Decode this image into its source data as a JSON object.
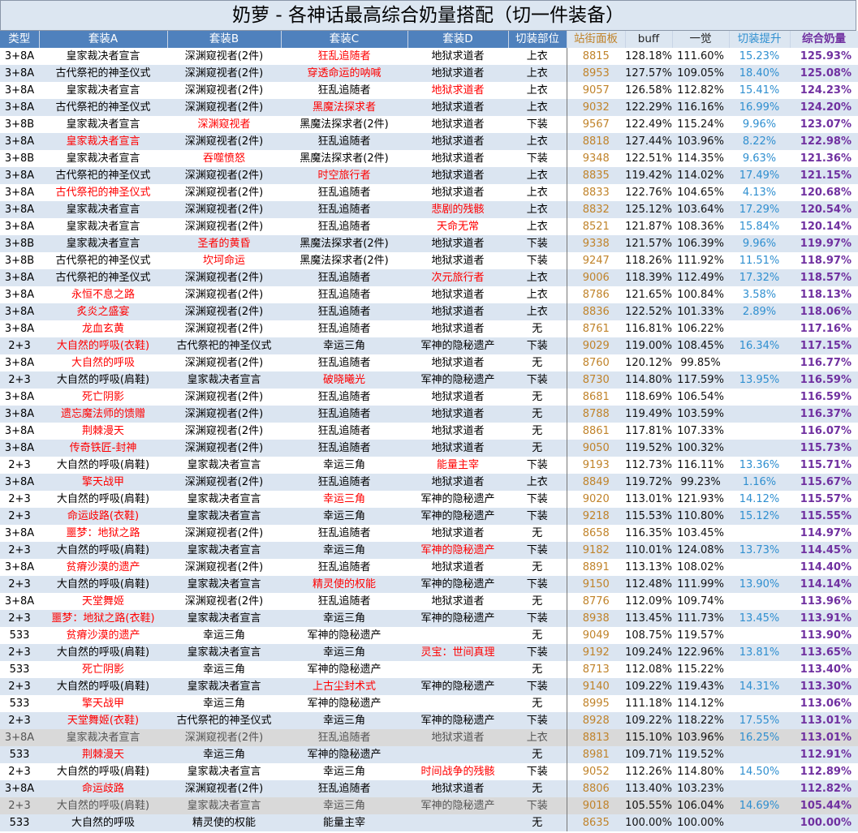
{
  "title": "奶萝 - 各神话最高综合奶量搭配（切一件装备）",
  "columns": [
    "类型",
    "套装A",
    "套装B",
    "套装C",
    "套装D",
    "切装部位",
    "站街面板",
    "buff",
    "一觉",
    "切装提升",
    "综合奶量"
  ],
  "rows": [
    {
      "type": "3+8A",
      "a": "皇家裁决者宣言",
      "b": "深渊窥视者(2件)",
      "c": "狂乱追随者",
      "d": "地狱求道者",
      "part": "上衣",
      "panel": "8815",
      "buff": "128.18%",
      "ov": "111.60%",
      "sw": "15.23%",
      "total": "125.93%",
      "red": [
        "c"
      ]
    },
    {
      "type": "3+8A",
      "a": "古代祭祀的神圣仪式",
      "b": "深渊窥视者(2件)",
      "c": "穿透命运的呐喊",
      "d": "地狱求道者",
      "part": "上衣",
      "panel": "8953",
      "buff": "127.57%",
      "ov": "109.05%",
      "sw": "18.40%",
      "total": "125.08%",
      "red": [
        "c"
      ]
    },
    {
      "type": "3+8A",
      "a": "皇家裁决者宣言",
      "b": "深渊窥视者(2件)",
      "c": "狂乱追随者",
      "d": "地狱求道者",
      "part": "上衣",
      "panel": "9057",
      "buff": "126.58%",
      "ov": "112.82%",
      "sw": "15.41%",
      "total": "124.23%",
      "red": [
        "d"
      ]
    },
    {
      "type": "3+8A",
      "a": "古代祭祀的神圣仪式",
      "b": "深渊窥视者(2件)",
      "c": "黑魔法探求者",
      "d": "地狱求道者",
      "part": "上衣",
      "panel": "9032",
      "buff": "122.29%",
      "ov": "116.16%",
      "sw": "16.99%",
      "total": "124.20%",
      "red": [
        "c"
      ]
    },
    {
      "type": "3+8B",
      "a": "皇家裁决者宣言",
      "b": "深渊窥视者",
      "c": "黑魔法探求者(2件)",
      "d": "地狱求道者",
      "part": "下装",
      "panel": "9567",
      "buff": "122.49%",
      "ov": "115.24%",
      "sw": "9.96%",
      "total": "123.07%",
      "red": [
        "b"
      ]
    },
    {
      "type": "3+8A",
      "a": "皇家裁决者宣言",
      "b": "深渊窥视者(2件)",
      "c": "狂乱追随者",
      "d": "地狱求道者",
      "part": "上衣",
      "panel": "8818",
      "buff": "127.44%",
      "ov": "103.96%",
      "sw": "8.22%",
      "total": "122.98%",
      "red": [
        "a"
      ]
    },
    {
      "type": "3+8B",
      "a": "皇家裁决者宣言",
      "b": "吞噬愤怒",
      "c": "黑魔法探求者(2件)",
      "d": "地狱求道者",
      "part": "下装",
      "panel": "9348",
      "buff": "122.51%",
      "ov": "114.35%",
      "sw": "9.63%",
      "total": "121.36%",
      "red": [
        "b"
      ]
    },
    {
      "type": "3+8A",
      "a": "古代祭祀的神圣仪式",
      "b": "深渊窥视者(2件)",
      "c": "时空旅行者",
      "d": "地狱求道者",
      "part": "上衣",
      "panel": "8835",
      "buff": "119.42%",
      "ov": "114.02%",
      "sw": "17.49%",
      "total": "121.15%",
      "red": [
        "c"
      ]
    },
    {
      "type": "3+8A",
      "a": "古代祭祀的神圣仪式",
      "b": "深渊窥视者(2件)",
      "c": "狂乱追随者",
      "d": "地狱求道者",
      "part": "上衣",
      "panel": "8833",
      "buff": "122.76%",
      "ov": "104.65%",
      "sw": "4.13%",
      "total": "120.68%",
      "red": [
        "a"
      ]
    },
    {
      "type": "3+8A",
      "a": "皇家裁决者宣言",
      "b": "深渊窥视者(2件)",
      "c": "狂乱追随者",
      "d": "悲剧的残骸",
      "part": "上衣",
      "panel": "8832",
      "buff": "125.12%",
      "ov": "103.64%",
      "sw": "17.29%",
      "total": "120.54%",
      "red": [
        "d"
      ]
    },
    {
      "type": "3+8A",
      "a": "皇家裁决者宣言",
      "b": "深渊窥视者(2件)",
      "c": "狂乱追随者",
      "d": "天命无常",
      "part": "上衣",
      "panel": "8521",
      "buff": "121.87%",
      "ov": "108.36%",
      "sw": "15.84%",
      "total": "120.14%",
      "red": [
        "d"
      ]
    },
    {
      "type": "3+8B",
      "a": "皇家裁决者宣言",
      "b": "圣者的黄昏",
      "c": "黑魔法探求者(2件)",
      "d": "地狱求道者",
      "part": "下装",
      "panel": "9338",
      "buff": "121.57%",
      "ov": "106.39%",
      "sw": "9.96%",
      "total": "119.97%",
      "red": [
        "b"
      ]
    },
    {
      "type": "3+8B",
      "a": "古代祭祀的神圣仪式",
      "b": "坎坷命运",
      "c": "黑魔法探求者(2件)",
      "d": "地狱求道者",
      "part": "下装",
      "panel": "9247",
      "buff": "118.26%",
      "ov": "111.92%",
      "sw": "11.51%",
      "total": "118.97%",
      "red": [
        "b"
      ]
    },
    {
      "type": "3+8A",
      "a": "古代祭祀的神圣仪式",
      "b": "深渊窥视者(2件)",
      "c": "狂乱追随者",
      "d": "次元旅行者",
      "part": "上衣",
      "panel": "9006",
      "buff": "118.39%",
      "ov": "112.49%",
      "sw": "17.32%",
      "total": "118.57%",
      "red": [
        "d"
      ]
    },
    {
      "type": "3+8A",
      "a": "永恒不息之路",
      "b": "深渊窥视者(2件)",
      "c": "狂乱追随者",
      "d": "地狱求道者",
      "part": "上衣",
      "panel": "8786",
      "buff": "121.65%",
      "ov": "100.84%",
      "sw": "3.58%",
      "total": "118.13%",
      "red": [
        "a"
      ]
    },
    {
      "type": "3+8A",
      "a": "炙炎之盛宴",
      "b": "深渊窥视者(2件)",
      "c": "狂乱追随者",
      "d": "地狱求道者",
      "part": "上衣",
      "panel": "8836",
      "buff": "122.52%",
      "ov": "101.33%",
      "sw": "2.89%",
      "total": "118.06%",
      "red": [
        "a"
      ]
    },
    {
      "type": "3+8A",
      "a": "龙血玄黄",
      "b": "深渊窥视者(2件)",
      "c": "狂乱追随者",
      "d": "地狱求道者",
      "part": "无",
      "panel": "8761",
      "buff": "116.81%",
      "ov": "106.22%",
      "sw": "",
      "total": "117.16%",
      "red": [
        "a"
      ]
    },
    {
      "type": "2+3",
      "a": "大自然的呼吸(衣鞋)",
      "b": "古代祭祀的神圣仪式",
      "c": "幸运三角",
      "d": "军神的隐秘遗产",
      "part": "下装",
      "panel": "9029",
      "buff": "119.00%",
      "ov": "108.45%",
      "sw": "16.34%",
      "total": "117.15%",
      "red": [
        "a"
      ]
    },
    {
      "type": "3+8A",
      "a": "大自然的呼吸",
      "b": "深渊窥视者(2件)",
      "c": "狂乱追随者",
      "d": "地狱求道者",
      "part": "无",
      "panel": "8760",
      "buff": "120.12%",
      "ov": "99.85%",
      "sw": "",
      "total": "116.77%",
      "red": [
        "a"
      ]
    },
    {
      "type": "2+3",
      "a": "大自然的呼吸(肩鞋)",
      "b": "皇家裁决者宣言",
      "c": "破晓曦光",
      "d": "军神的隐秘遗产",
      "part": "下装",
      "panel": "8730",
      "buff": "114.80%",
      "ov": "117.59%",
      "sw": "13.95%",
      "total": "116.59%",
      "red": [
        "c"
      ]
    },
    {
      "type": "3+8A",
      "a": "死亡阴影",
      "b": "深渊窥视者(2件)",
      "c": "狂乱追随者",
      "d": "地狱求道者",
      "part": "无",
      "panel": "8681",
      "buff": "118.69%",
      "ov": "106.54%",
      "sw": "",
      "total": "116.59%",
      "red": [
        "a"
      ]
    },
    {
      "type": "3+8A",
      "a": "遗忘魔法师的馈赠",
      "b": "深渊窥视者(2件)",
      "c": "狂乱追随者",
      "d": "地狱求道者",
      "part": "无",
      "panel": "8788",
      "buff": "119.49%",
      "ov": "103.59%",
      "sw": "",
      "total": "116.37%",
      "red": [
        "a"
      ]
    },
    {
      "type": "3+8A",
      "a": "荆棘漫天",
      "b": "深渊窥视者(2件)",
      "c": "狂乱追随者",
      "d": "地狱求道者",
      "part": "无",
      "panel": "8861",
      "buff": "117.81%",
      "ov": "107.33%",
      "sw": "",
      "total": "116.07%",
      "red": [
        "a"
      ]
    },
    {
      "type": "3+8A",
      "a": "传奇铁匠-封神",
      "b": "深渊窥视者(2件)",
      "c": "狂乱追随者",
      "d": "地狱求道者",
      "part": "无",
      "panel": "9050",
      "buff": "119.52%",
      "ov": "100.32%",
      "sw": "",
      "total": "115.73%",
      "red": [
        "a"
      ]
    },
    {
      "type": "2+3",
      "a": "大自然的呼吸(肩鞋)",
      "b": "皇家裁决者宣言",
      "c": "幸运三角",
      "d": "能量主宰",
      "part": "下装",
      "panel": "9193",
      "buff": "112.73%",
      "ov": "116.11%",
      "sw": "13.36%",
      "total": "115.71%",
      "red": [
        "d"
      ]
    },
    {
      "type": "3+8A",
      "a": "擎天战甲",
      "b": "深渊窥视者(2件)",
      "c": "狂乱追随者",
      "d": "地狱求道者",
      "part": "上衣",
      "panel": "8849",
      "buff": "119.72%",
      "ov": "99.23%",
      "sw": "1.16%",
      "total": "115.67%",
      "red": [
        "a"
      ]
    },
    {
      "type": "2+3",
      "a": "大自然的呼吸(肩鞋)",
      "b": "皇家裁决者宣言",
      "c": "幸运三角",
      "d": "军神的隐秘遗产",
      "part": "下装",
      "panel": "9020",
      "buff": "113.01%",
      "ov": "121.93%",
      "sw": "14.12%",
      "total": "115.57%",
      "red": [
        "c"
      ]
    },
    {
      "type": "2+3",
      "a": "命运歧路(衣鞋)",
      "b": "皇家裁决者宣言",
      "c": "幸运三角",
      "d": "军神的隐秘遗产",
      "part": "下装",
      "panel": "9218",
      "buff": "115.53%",
      "ov": "110.80%",
      "sw": "15.12%",
      "total": "115.55%",
      "red": [
        "a"
      ]
    },
    {
      "type": "3+8A",
      "a": "噩梦：地狱之路",
      "b": "深渊窥视者(2件)",
      "c": "狂乱追随者",
      "d": "地狱求道者",
      "part": "无",
      "panel": "8658",
      "buff": "116.35%",
      "ov": "103.45%",
      "sw": "",
      "total": "114.97%",
      "red": [
        "a"
      ]
    },
    {
      "type": "2+3",
      "a": "大自然的呼吸(肩鞋)",
      "b": "皇家裁决者宣言",
      "c": "幸运三角",
      "d": "军神的隐秘遗产",
      "part": "下装",
      "panel": "9182",
      "buff": "110.01%",
      "ov": "124.08%",
      "sw": "13.73%",
      "total": "114.45%",
      "red": [
        "d"
      ]
    },
    {
      "type": "3+8A",
      "a": "贫瘠沙漠的遗产",
      "b": "深渊窥视者(2件)",
      "c": "狂乱追随者",
      "d": "地狱求道者",
      "part": "无",
      "panel": "8891",
      "buff": "113.13%",
      "ov": "108.02%",
      "sw": "",
      "total": "114.40%",
      "red": [
        "a"
      ]
    },
    {
      "type": "2+3",
      "a": "大自然的呼吸(肩鞋)",
      "b": "皇家裁决者宣言",
      "c": "精灵使的权能",
      "d": "军神的隐秘遗产",
      "part": "下装",
      "panel": "9150",
      "buff": "112.48%",
      "ov": "111.99%",
      "sw": "13.90%",
      "total": "114.14%",
      "red": [
        "c"
      ]
    },
    {
      "type": "3+8A",
      "a": "天堂舞姬",
      "b": "深渊窥视者(2件)",
      "c": "狂乱追随者",
      "d": "地狱求道者",
      "part": "无",
      "panel": "8776",
      "buff": "112.09%",
      "ov": "109.74%",
      "sw": "",
      "total": "113.96%",
      "red": [
        "a"
      ]
    },
    {
      "type": "2+3",
      "a": "噩梦：地狱之路(衣鞋)",
      "b": "皇家裁决者宣言",
      "c": "幸运三角",
      "d": "军神的隐秘遗产",
      "part": "下装",
      "panel": "8938",
      "buff": "113.45%",
      "ov": "111.73%",
      "sw": "13.45%",
      "total": "113.91%",
      "red": [
        "a"
      ]
    },
    {
      "type": "533",
      "a": "贫瘠沙漠的遗产",
      "b": "幸运三角",
      "c": "军神的隐秘遗产",
      "d": "",
      "part": "无",
      "panel": "9049",
      "buff": "108.75%",
      "ov": "119.57%",
      "sw": "",
      "total": "113.90%",
      "red": [
        "a"
      ]
    },
    {
      "type": "2+3",
      "a": "大自然的呼吸(肩鞋)",
      "b": "皇家裁决者宣言",
      "c": "幸运三角",
      "d": "灵宝：世间真理",
      "part": "下装",
      "panel": "9192",
      "buff": "109.24%",
      "ov": "122.96%",
      "sw": "13.81%",
      "total": "113.65%",
      "red": [
        "d"
      ]
    },
    {
      "type": "533",
      "a": "死亡阴影",
      "b": "幸运三角",
      "c": "军神的隐秘遗产",
      "d": "",
      "part": "无",
      "panel": "8713",
      "buff": "112.08%",
      "ov": "115.22%",
      "sw": "",
      "total": "113.40%",
      "red": [
        "a"
      ]
    },
    {
      "type": "2+3",
      "a": "大自然的呼吸(肩鞋)",
      "b": "皇家裁决者宣言",
      "c": "上古尘封术式",
      "d": "军神的隐秘遗产",
      "part": "下装",
      "panel": "9140",
      "buff": "109.22%",
      "ov": "119.43%",
      "sw": "14.31%",
      "total": "113.30%",
      "red": [
        "c"
      ]
    },
    {
      "type": "533",
      "a": "擎天战甲",
      "b": "幸运三角",
      "c": "军神的隐秘遗产",
      "d": "",
      "part": "无",
      "panel": "8995",
      "buff": "111.18%",
      "ov": "114.12%",
      "sw": "",
      "total": "113.06%",
      "red": [
        "a"
      ]
    },
    {
      "type": "2+3",
      "a": "天堂舞姬(衣鞋)",
      "b": "古代祭祀的神圣仪式",
      "c": "幸运三角",
      "d": "军神的隐秘遗产",
      "part": "下装",
      "panel": "8928",
      "buff": "109.22%",
      "ov": "118.22%",
      "sw": "17.55%",
      "total": "113.01%",
      "red": [
        "a"
      ]
    },
    {
      "type": "3+8A",
      "a": "皇家裁决者宣言",
      "b": "深渊窥视者(2件)",
      "c": "狂乱追随者",
      "d": "地狱求道者",
      "part": "上衣",
      "panel": "8813",
      "buff": "115.10%",
      "ov": "103.96%",
      "sw": "16.25%",
      "total": "113.01%",
      "red": [],
      "grey": true
    },
    {
      "type": "533",
      "a": "荆棘漫天",
      "b": "幸运三角",
      "c": "军神的隐秘遗产",
      "d": "",
      "part": "无",
      "panel": "8981",
      "buff": "109.71%",
      "ov": "119.52%",
      "sw": "",
      "total": "112.91%",
      "red": [
        "a"
      ]
    },
    {
      "type": "2+3",
      "a": "大自然的呼吸(肩鞋)",
      "b": "皇家裁决者宣言",
      "c": "幸运三角",
      "d": "时间战争的残骸",
      "part": "下装",
      "panel": "9052",
      "buff": "112.26%",
      "ov": "114.80%",
      "sw": "14.50%",
      "total": "112.89%",
      "red": [
        "d"
      ]
    },
    {
      "type": "3+8A",
      "a": "命运歧路",
      "b": "深渊窥视者(2件)",
      "c": "狂乱追随者",
      "d": "地狱求道者",
      "part": "无",
      "panel": "8806",
      "buff": "113.40%",
      "ov": "103.23%",
      "sw": "",
      "total": "112.82%",
      "red": [
        "a"
      ]
    },
    {
      "type": "2+3",
      "a": "大自然的呼吸(肩鞋)",
      "b": "皇家裁决者宣言",
      "c": "幸运三角",
      "d": "军神的隐秘遗产",
      "part": "下装",
      "panel": "9018",
      "buff": "105.55%",
      "ov": "106.04%",
      "sw": "14.69%",
      "total": "105.44%",
      "red": [],
      "grey": true
    },
    {
      "type": "533",
      "a": "大自然的呼吸",
      "b": "精灵使的权能",
      "c": "能量主宰",
      "d": "",
      "part": "无",
      "panel": "8635",
      "buff": "100.00%",
      "ov": "100.00%",
      "sw": "",
      "total": "100.00%",
      "red": []
    }
  ]
}
